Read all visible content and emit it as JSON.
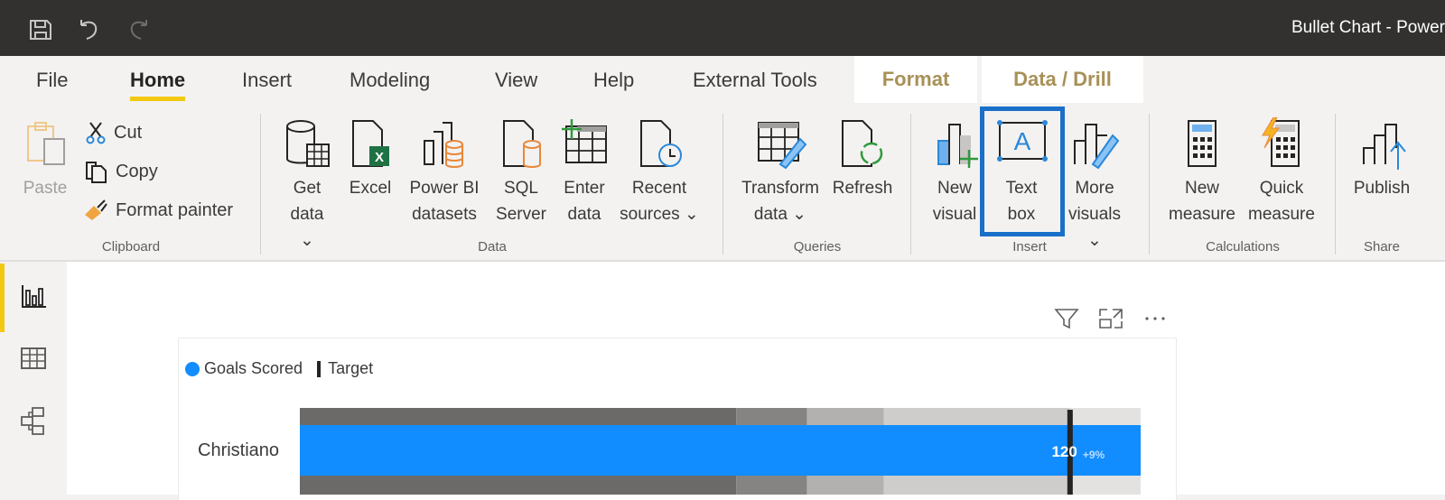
{
  "window": {
    "title": "Bullet Chart - Power",
    "quick_access": [
      {
        "icon": "save-icon"
      },
      {
        "icon": "undo-icon"
      },
      {
        "icon": "redo-icon"
      }
    ]
  },
  "tabs": [
    {
      "label": "File"
    },
    {
      "label": "Home",
      "active": true
    },
    {
      "label": "Insert"
    },
    {
      "label": "Modeling"
    },
    {
      "label": "View"
    },
    {
      "label": "Help"
    },
    {
      "label": "External Tools"
    },
    {
      "label": "Format",
      "contextual": true
    },
    {
      "label": "Data / Drill",
      "contextual": true
    }
  ],
  "ribbon": {
    "clipboard": {
      "label": "Clipboard",
      "paste": "Paste",
      "cut": "Cut",
      "copy": "Copy",
      "format_painter": "Format painter"
    },
    "data": {
      "label": "Data",
      "get_data": [
        "Get",
        "data ⌄"
      ],
      "excel": [
        "Excel",
        ""
      ],
      "powerbi_datasets": [
        "Power BI",
        "datasets"
      ],
      "sql_server": [
        "SQL",
        "Server"
      ],
      "enter_data": [
        "Enter",
        "data"
      ],
      "recent_sources": [
        "Recent",
        "sources ⌄"
      ]
    },
    "queries": {
      "label": "Queries",
      "transform_data": [
        "Transform",
        "data ⌄"
      ],
      "refresh": [
        "Refresh",
        ""
      ]
    },
    "insert": {
      "label": "Insert",
      "new_visual": [
        "New",
        "visual"
      ],
      "text_box": [
        "Text",
        "box"
      ],
      "more_visuals": [
        "More",
        "visuals ⌄"
      ]
    },
    "calculations": {
      "label": "Calculations",
      "new_measure": [
        "New",
        "measure"
      ],
      "quick_measure": [
        "Quick",
        "measure"
      ]
    },
    "share": {
      "label": "Share",
      "publish": [
        "Publish",
        ""
      ]
    }
  },
  "left_nav": [
    {
      "icon": "report-view-icon",
      "active": true
    },
    {
      "icon": "data-view-icon"
    },
    {
      "icon": "model-view-icon"
    }
  ],
  "visual_header": [
    {
      "icon": "filter-icon"
    },
    {
      "icon": "focus-mode-icon"
    },
    {
      "icon": "more-options-icon"
    }
  ],
  "chart_data": {
    "type": "bar",
    "subtype": "bullet",
    "legend": [
      {
        "label": "Goals Scored",
        "marker": "dot",
        "color": "#118dff"
      },
      {
        "label": "Target",
        "marker": "tick",
        "color": "#252423"
      }
    ],
    "legend_position": "top-left",
    "categories": [
      "Christiano"
    ],
    "series": [
      {
        "name": "Goals Scored",
        "values": [
          131
        ]
      },
      {
        "name": "Target",
        "values": [
          120
        ]
      }
    ],
    "bands": [
      {
        "to": 68,
        "color": "#6b6a69"
      },
      {
        "to": 79,
        "color": "#858483"
      },
      {
        "to": 91,
        "color": "#b3b1b0"
      },
      {
        "to": 120,
        "color": "#cfcdcc"
      },
      {
        "to": 131,
        "color": "#e4e2e1"
      }
    ],
    "data_labels": [
      {
        "value": "120",
        "delta": "+9%"
      }
    ],
    "xlim": [
      0,
      131
    ],
    "bar_color": "#118dff",
    "target_color": "#252423"
  }
}
